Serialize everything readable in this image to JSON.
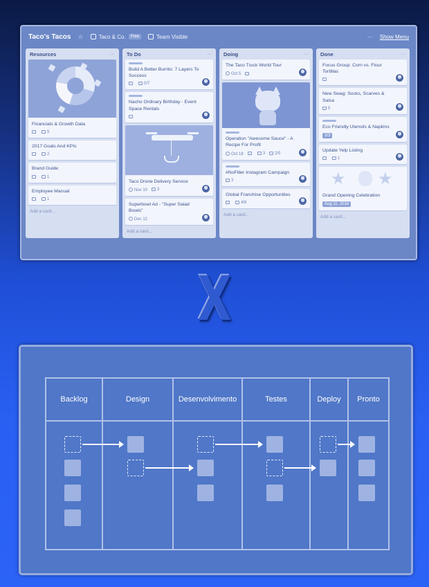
{
  "board": {
    "title": "Taco's Tacos",
    "team_name": "Taco & Co.",
    "team_badge": "Free",
    "visibility": "Team Visible",
    "show_menu": "Show Menu",
    "menu_dots": "···",
    "add_card": "Add a card...",
    "lists": [
      {
        "title": "Resources",
        "cards": [
          {
            "title": "Financials & Growth Data",
            "comments": "",
            "attachments": "5"
          },
          {
            "title": "2017 Goals And KPIs",
            "attachments": "2"
          },
          {
            "title": "Brand Guide",
            "attachments": "1"
          },
          {
            "title": "Employee Manual",
            "attachments": "1"
          }
        ]
      },
      {
        "title": "To Do",
        "cards": [
          {
            "title": "Build A Better Burrito: 7 Layers To Success",
            "checklist": "0/7"
          },
          {
            "title": "Nacho Ordinary Birthday - Event Space Rentals"
          },
          {
            "title": "Taco Drone Delivery Service",
            "due": "Nov 10",
            "attachments": "3"
          },
          {
            "title": "Superbowl Ad - \"Super Salad Bowls\"",
            "due": "Dec 12"
          }
        ]
      },
      {
        "title": "Doing",
        "cards": [
          {
            "title": "The Taco Truck World Tour",
            "due": "Oct 5"
          },
          {
            "title": "Operation \"Awesome Sauce\" - A Recipe For Profit",
            "due": "Oct 18",
            "attachments": "3",
            "checklist": "2/5"
          },
          {
            "title": "#NoFiller Instagram Campaign",
            "attachments": "3"
          },
          {
            "title": "Global Franchise Opportunities",
            "checklist": "4/9"
          }
        ]
      },
      {
        "title": "Done",
        "cards": [
          {
            "title": "Focus Group: Corn vs. Flour Tortillas"
          },
          {
            "title": "New Swag: Socks, Scarves & Salsa",
            "attachments": "5"
          },
          {
            "title": "Eco Friendly Utensils & Napkins",
            "checklist": "3/3"
          },
          {
            "title": "Update Yelp Listing",
            "attachments": "1"
          },
          {
            "title": "Grand Opening Celebration",
            "due": "Aug 11, 2016"
          }
        ]
      }
    ]
  },
  "separator": "X",
  "kanban": {
    "columns": [
      "Backlog",
      "Design",
      "Desenvolvimento",
      "Testes",
      "Deploy",
      "Pronto"
    ]
  }
}
